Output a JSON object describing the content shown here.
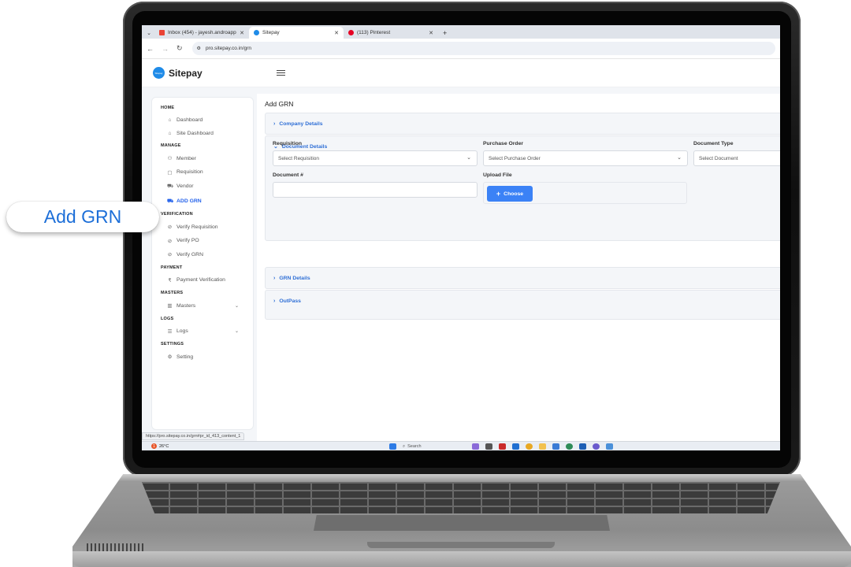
{
  "browser": {
    "tabs": [
      {
        "label": "Inbox (454) - jayesh.androapp",
        "favicon": "gmail-icon",
        "active": false
      },
      {
        "label": "Sitepay",
        "favicon": "sitepay-icon",
        "active": true
      },
      {
        "label": "(113) Pinterest",
        "favicon": "pinterest-icon",
        "active": false
      }
    ],
    "url": "pro.sitepay.co.in/grn",
    "status_url": "https://pro.sitepay.co.in/grn#pr_id_413_content_1"
  },
  "app": {
    "brand": "Sitepay",
    "logo_text": "Sitepay",
    "accent": "#2563eb"
  },
  "sidebar": {
    "sections": [
      {
        "title": "HOME",
        "items": [
          {
            "label": "Dashboard",
            "icon": "home-icon"
          },
          {
            "label": "Site Dashboard",
            "icon": "site-icon"
          }
        ]
      },
      {
        "title": "MANAGE",
        "items": [
          {
            "label": "Member",
            "icon": "users-icon"
          },
          {
            "label": "Requisition",
            "icon": "requisition-icon"
          },
          {
            "label": "Vendor",
            "icon": "cart-icon"
          },
          {
            "label": "ADD GRN",
            "icon": "truck-icon",
            "active": true
          }
        ]
      },
      {
        "title": "VERIFICATION",
        "items": [
          {
            "label": "Verify Requisition",
            "icon": "check-circle-icon"
          },
          {
            "label": "Verify PO",
            "icon": "check-circle-icon"
          },
          {
            "label": "Verify GRN",
            "icon": "check-circle-icon"
          }
        ]
      },
      {
        "title": "PAYMENT",
        "items": [
          {
            "label": "Payment Verification",
            "icon": "rupee-icon"
          }
        ]
      },
      {
        "title": "MASTERS",
        "items": [
          {
            "label": "Masters",
            "icon": "chart-icon",
            "expandable": true
          }
        ]
      },
      {
        "title": "LOGS",
        "items": [
          {
            "label": "Logs",
            "icon": "database-icon",
            "expandable": true
          }
        ]
      },
      {
        "title": "SETTINGS",
        "items": [
          {
            "label": "Setting",
            "icon": "gear-icon"
          }
        ]
      }
    ]
  },
  "main": {
    "title": "Add GRN",
    "accordions": {
      "company": "Company Details",
      "document": "Document Details",
      "grn": "GRN Details",
      "outpass": "OutPass"
    },
    "form": {
      "requisition_label": "Requisition",
      "requisition_placeholder": "Select Requisition",
      "po_label": "Purchase Order",
      "po_placeholder": "Select Purchase Order",
      "doctype_label": "Document Type",
      "doctype_placeholder": "Select Document",
      "docnum_label": "Document #",
      "docnum_value": "",
      "upload_label": "Upload File",
      "choose_label": "Choose"
    }
  },
  "taskbar": {
    "temperature": "26°C",
    "search_placeholder": "Search"
  },
  "callout": {
    "text": "Add GRN"
  }
}
